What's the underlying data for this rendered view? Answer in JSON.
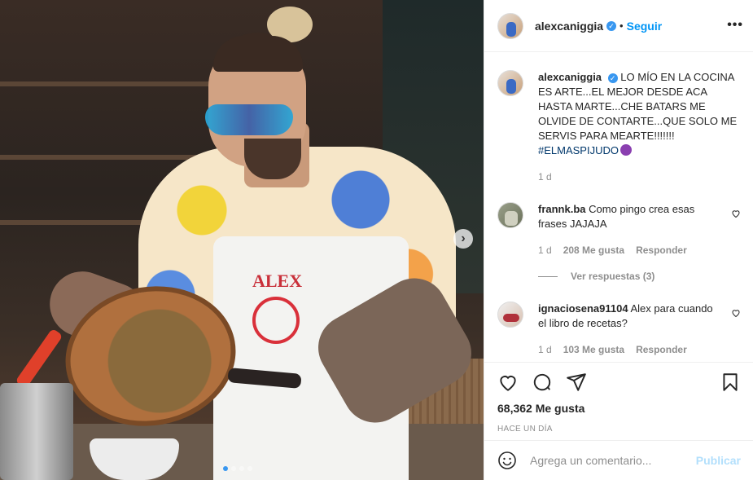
{
  "post": {
    "username": "alexcaniggia",
    "follow_label": "Seguir",
    "more_label": "•••",
    "separator": "•"
  },
  "caption": {
    "username": "alexcaniggia",
    "text": "LO MÍO EN LA COCINA ES ARTE...EL MEJOR DESDE ACA HASTA MARTE...CHE BATARS ME OLVIDE DE CONTARTE...QUE SOLO ME SERVIS PARA MEARTE!!!!!!!",
    "hashtag": "#ELMASPIJUDO",
    "time": "1 d"
  },
  "comments": [
    {
      "username": "frannk.ba",
      "text": "Como pingo crea esas frases JAJAJA",
      "time": "1 d",
      "likes": "208 Me gusta",
      "reply_label": "Responder"
    },
    {
      "username": "ignaciosena91104",
      "text": "Alex para cuando el libro de recetas?",
      "time": "1 d",
      "likes": "103 Me gusta",
      "reply_label": "Responder"
    }
  ],
  "view_replies": "Ver respuestas (3)",
  "stats": {
    "likes": "68,362 Me gusta",
    "posted": "HACE UN DÍA"
  },
  "add_comment": {
    "placeholder": "Agrega un comentario...",
    "publish_label": "Publicar"
  },
  "photo": {
    "apron_text": "ALEX",
    "next_arrow": "›",
    "carousel_dots": 4,
    "active_dot": 1
  },
  "colors": {
    "link_blue": "#0095f6",
    "publish_disabled": "#b2dffc",
    "hashtag": "#00376b",
    "muted": "#8e8e8e"
  },
  "icons": [
    "heart-icon",
    "comment-icon",
    "share-icon",
    "bookmark-icon",
    "emoji-icon",
    "verified-icon",
    "more-icon",
    "chevron-right-icon"
  ]
}
